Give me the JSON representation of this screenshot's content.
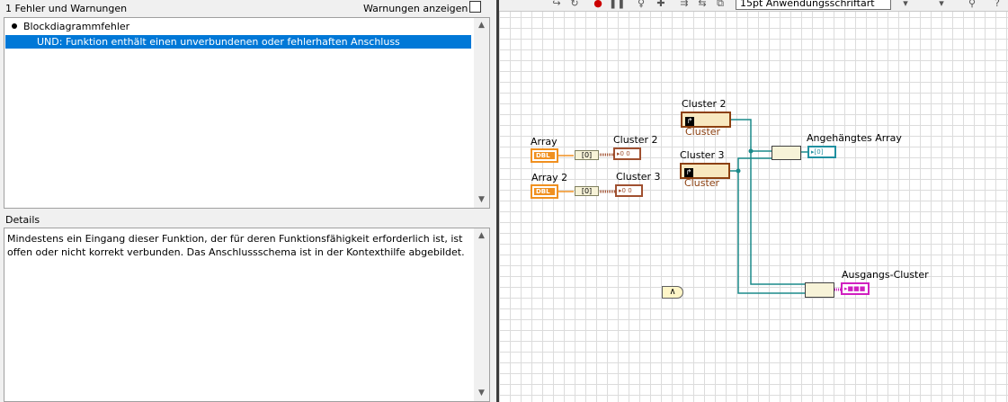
{
  "errors_panel": {
    "count_text": "1 Fehler und Warnungen",
    "show_warnings_label": "Warnungen anzeigen",
    "show_warnings_checked": false,
    "category": "Blockdiagrammfehler",
    "selected_error": "UND: Funktion enthält einen unverbundenen oder fehlerhaften Anschluss",
    "details_label": "Details",
    "details_text": "Mindestens ein Eingang dieser Funktion, der für deren Funktionsfähigkeit erforderlich ist, ist offen oder nicht korrekt verbunden. Das Anschlussschema ist in der Kontexthilfe abgebildet."
  },
  "toolbar": {
    "font_combo": "15pt Anwendungsschriftart",
    "icons": [
      "step-into-icon",
      "retain-wire-values-icon",
      "abort-icon",
      "pause-icon",
      "highlight-execution-icon",
      "clean-up-diagram-icon",
      "distribute-icon",
      "align-icon",
      "reorder-icon",
      "resize-icon",
      "search-icon"
    ]
  },
  "diagram": {
    "labels": {
      "array1": "Array",
      "array2": "Array 2",
      "cluster2_out": "Cluster 2",
      "cluster3_out": "Cluster 3",
      "cluster2_ctl": "Cluster 2",
      "cluster3_ctl": "Cluster 3",
      "appended": "Angehängtes Array",
      "output_cluster": "Ausgangs-Cluster"
    },
    "terminal_text": {
      "dbl": "DBL",
      "cluster_ctl": "Cluster",
      "cluster_ind": "▸0 0",
      "array_ind": "▸[0]",
      "pink_ind": "▸■■■",
      "compare": "∧"
    },
    "colors": {
      "orange": "#f09020",
      "cluster_brown": "#8c4010",
      "wire_teal": "#1a8a8a",
      "pink": "#d020c0"
    }
  }
}
